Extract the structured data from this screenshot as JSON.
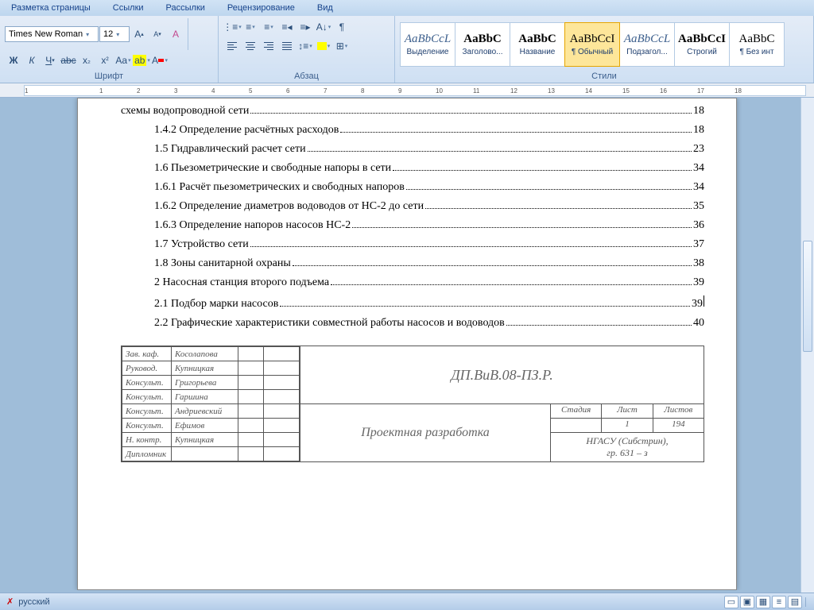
{
  "tabs": [
    "Разметка страницы",
    "Ссылки",
    "Рассылки",
    "Рецензирование",
    "Вид"
  ],
  "font": {
    "name": "Times New Roman",
    "size": "12"
  },
  "groups": {
    "font": "Шрифт",
    "paragraph": "Абзац",
    "styles": "Стили"
  },
  "styles_gallery": [
    {
      "preview": "AaBbCcL",
      "name": "Выделение",
      "italic": true
    },
    {
      "preview": "AaBbC",
      "name": "Заголово...",
      "bold": true
    },
    {
      "preview": "AaBbC",
      "name": "Название",
      "bold": true
    },
    {
      "preview": "AaBbCcI",
      "name": "¶ Обычный",
      "active": true
    },
    {
      "preview": "AaBbCcL",
      "name": "Подзагол...",
      "italic": true
    },
    {
      "preview": "AaBbCcI",
      "name": "Строгий",
      "bold": true
    },
    {
      "preview": "AaBbC",
      "name": "¶ Без инт"
    }
  ],
  "toc": [
    {
      "text": "схемы водопроводной сети",
      "page": "18",
      "indent": 0
    },
    {
      "text": "1.4.2 Определение расчётных расходов",
      "page": "18",
      "indent": 1
    },
    {
      "text": "1.5 Гидравлический расчет сети",
      "page": "23",
      "indent": 1
    },
    {
      "text": "1.6 Пьезометрические и свободные напоры в сети",
      "page": "34",
      "indent": 1
    },
    {
      "text": "1.6.1 Расчёт пьезометрических и свободных напоров",
      "page": "34",
      "indent": 1
    },
    {
      "text": "1.6.2 Определение диаметров водоводов от НС-2 до сети",
      "page": "35",
      "indent": 1
    },
    {
      "text": "1.6.3 Определение напоров насосов НС-2",
      "page": "36",
      "indent": 1
    },
    {
      "text": "1.7 Устройство сети",
      "page": "37",
      "indent": 1
    },
    {
      "text": "1.8 Зоны санитарной охраны",
      "page": "38",
      "indent": 1
    },
    {
      "text": "2 Насосная станция второго подъема",
      "page": "39",
      "indent": 1
    },
    {
      "text": "2.1 Подбор марки насосов",
      "page": "39",
      "indent": 1,
      "cursor": true
    },
    {
      "text": "2.2 Графические характеристики совместной работы насосов и водоводов",
      "page": "40",
      "indent": 1
    }
  ],
  "stamp": {
    "left_rows": [
      [
        "Зав. каф.",
        "Косолапова"
      ],
      [
        "Руковод.",
        "Купницкая"
      ],
      [
        "Консульт.",
        "Григорьева"
      ],
      [
        "Консульт.",
        "Гаршина"
      ],
      [
        "Консульт.",
        "Андриевский"
      ],
      [
        "Консульт.",
        "Ефимов"
      ],
      [
        "Н. контр.",
        "Купницкая"
      ],
      [
        "Дипломник",
        ""
      ]
    ],
    "code": "ДП.ВиВ.08-ПЗ.Р.",
    "title": "Проектная разработка",
    "headers": [
      "Стадия",
      "Лист",
      "Листов"
    ],
    "values": [
      "",
      "1",
      "194"
    ],
    "org": "НГАСУ (Сибстрин),\nгр. 631 – з"
  },
  "status": {
    "lang": "русский"
  },
  "ruler_marks": [
    "1",
    "",
    "1",
    "2",
    "3",
    "4",
    "5",
    "6",
    "7",
    "8",
    "9",
    "10",
    "11",
    "12",
    "13",
    "14",
    "15",
    "16",
    "17",
    "18"
  ]
}
